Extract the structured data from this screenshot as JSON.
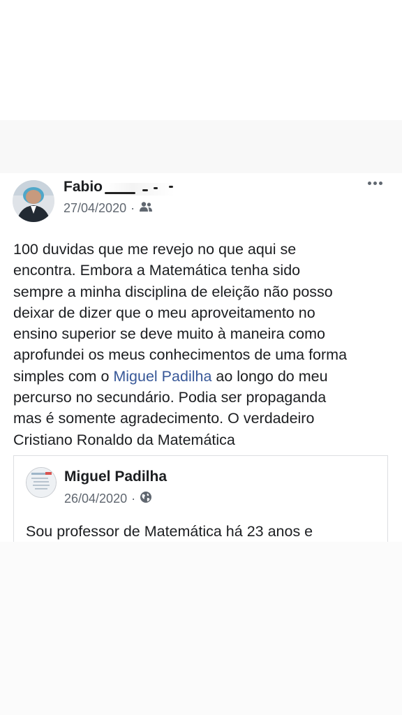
{
  "post": {
    "author": "Fabio",
    "date": "27/04/2020",
    "separator": "·",
    "audience_icon": "friends-icon",
    "more_icon": "more-options-icon",
    "text_lines": [
      "100 duvidas que me revejo no que aqui se",
      "encontra. Embora a Matemática tenha sido",
      "sempre a minha disciplina de eleição não posso",
      "deixar de dizer que o meu aproveitamento no",
      "ensino superior se deve muito à maneira como",
      "aprofundei os meus conhecimentos de uma forma"
    ],
    "mention_line": {
      "before": "simples com o ",
      "mention": "Miguel Padilha",
      "after": " ao longo do meu"
    },
    "text_lines_end": [
      "percurso no secundário. Podia ser propaganda",
      "mas é somente agradecimento. O verdadeiro",
      "Cristiano Ronaldo da Matemática"
    ]
  },
  "shared_post": {
    "author": "Miguel Padilha",
    "date": "26/04/2020",
    "separator": "·",
    "audience_icon": "public-globe-icon",
    "text_preview": "Sou professor de Matemática há 23 anos e"
  },
  "colors": {
    "text": "#1c1e21",
    "secondary": "#606770",
    "link": "#385898",
    "border": "#dddfe2"
  }
}
